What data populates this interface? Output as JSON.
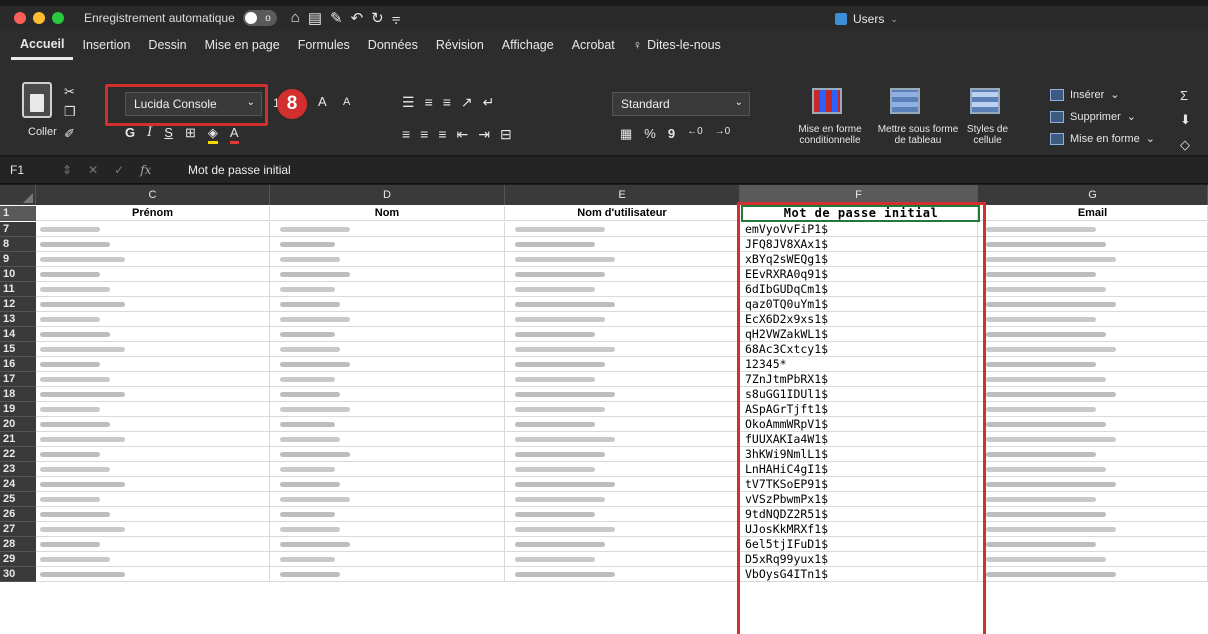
{
  "titlebar": {
    "autosave_label": "Enregistrement automatique",
    "autosave_state": "o",
    "doc_title": "Users",
    "traffic_colors": [
      "#ff5f57",
      "#febc2e",
      "#28c840"
    ]
  },
  "menu": {
    "tabs": [
      "Accueil",
      "Insertion",
      "Dessin",
      "Mise en page",
      "Formules",
      "Données",
      "Révision",
      "Affichage",
      "Acrobat",
      "Dites-le-nous"
    ],
    "active": "Accueil"
  },
  "ribbon": {
    "paste_label": "Coller",
    "font_name": "Lucida Console",
    "font_size": "11",
    "badge_number": "8",
    "grow_label": "A",
    "shrink_label": "A",
    "bold_label": "G",
    "italic_label": "I",
    "underline_label": "S",
    "number_format": "Standard",
    "percent_label": "%",
    "thousands_label": "9",
    "cond_format_label": "Mise en forme conditionnelle",
    "format_table_label": "Mettre sous forme de tableau",
    "cell_styles_label": "Styles de cellule",
    "insert_label": "Insérer",
    "delete_label": "Supprimer",
    "format_label": "Mise en forme",
    "highlight_color": "#d32f2f"
  },
  "formula_bar": {
    "cell_ref": "F1",
    "fx_label": "fx",
    "content": "Mot de passe initial"
  },
  "sheet": {
    "columns": [
      "C",
      "D",
      "E",
      "F",
      "G"
    ],
    "selected_column": "F",
    "headers": [
      "Prénom",
      "Nom",
      "Nom d'utilisateur",
      "Mot de passe initial",
      "Email"
    ],
    "rows": [
      {
        "num": "7",
        "password": "emVyoVvFiP1$"
      },
      {
        "num": "8",
        "password": "JFQ8JV8XAx1$"
      },
      {
        "num": "9",
        "password": "xBYq2sWEQg1$"
      },
      {
        "num": "10",
        "password": "EEvRXRA0q91$"
      },
      {
        "num": "11",
        "password": "6dIbGUDqCm1$"
      },
      {
        "num": "12",
        "password": "qaz0TQ0uYm1$"
      },
      {
        "num": "13",
        "password": "EcX6D2x9xs1$"
      },
      {
        "num": "14",
        "password": "qH2VWZakWL1$"
      },
      {
        "num": "15",
        "password": "68Ac3Cxtcy1$"
      },
      {
        "num": "16",
        "password": "12345*"
      },
      {
        "num": "17",
        "password": "7ZnJtmPbRX1$"
      },
      {
        "num": "18",
        "password": "s8uGG1IDUl1$"
      },
      {
        "num": "19",
        "password": "ASpAGrTjft1$"
      },
      {
        "num": "20",
        "password": "OkoAmmWRpV1$"
      },
      {
        "num": "21",
        "password": "fUUXAKIa4W1$"
      },
      {
        "num": "22",
        "password": "3hKWi9NmlL1$"
      },
      {
        "num": "23",
        "password": "LnHAHiC4gI1$"
      },
      {
        "num": "24",
        "password": "tV7TKSoEP91$"
      },
      {
        "num": "25",
        "password": "vVSzPbwmPx1$"
      },
      {
        "num": "26",
        "password": "9tdNQDZ2R51$"
      },
      {
        "num": "27",
        "password": "UJosKkMRXf1$"
      },
      {
        "num": "28",
        "password": "6el5tjIFuD1$"
      },
      {
        "num": "29",
        "password": "D5xRq99yux1$"
      },
      {
        "num": "30",
        "password": "VbOysG4ITn1$"
      }
    ],
    "header_row_num": "1"
  }
}
